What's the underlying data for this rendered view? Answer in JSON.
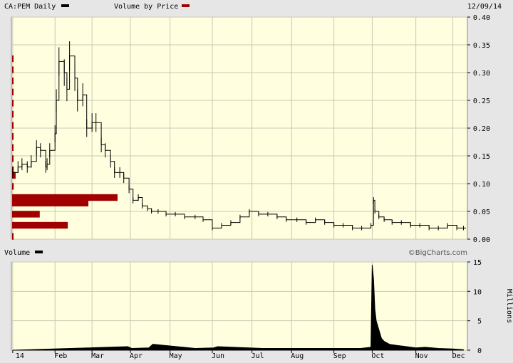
{
  "header": {
    "symbol_label": "CA:PEM Daily",
    "volume_by_price_label": "Volume by Price",
    "date": "12/09/14"
  },
  "volume_panel": {
    "label": "Volume",
    "watermark": "©BigCharts.com",
    "units_label": "Millions"
  },
  "colors": {
    "background": "#ffffe0",
    "grid": "#c8c8b4",
    "price_line": "#000000",
    "vbp_bar": "#a00000",
    "volume_fill": "#000000",
    "chrome": "#e6e6e6"
  },
  "chart_data": [
    {
      "type": "line",
      "title": "CA:PEM Daily",
      "x_tick_labels": [
        "14",
        "Feb",
        "Mar",
        "Apr",
        "May",
        "Jun",
        "Jul",
        "Aug",
        "Sep",
        "Oct",
        "Nov",
        "Dec"
      ],
      "y_tick_labels": [
        "0.00",
        "0.05",
        "0.10",
        "0.15",
        "0.20",
        "0.25",
        "0.30",
        "0.35",
        "0.40"
      ],
      "ylim": [
        0,
        0.4
      ],
      "grid": true,
      "series": [
        {
          "name": "CA:PEM Daily",
          "x": [
            "2014-01-02",
            "2014-01-06",
            "2014-01-09",
            "2014-01-13",
            "2014-01-16",
            "2014-01-20",
            "2014-01-23",
            "2014-01-27",
            "2014-01-28",
            "2014-01-30",
            "2014-02-03",
            "2014-02-04",
            "2014-02-06",
            "2014-02-10",
            "2014-02-12",
            "2014-02-14",
            "2014-02-18",
            "2014-02-20",
            "2014-02-24",
            "2014-02-27",
            "2014-03-03",
            "2014-03-06",
            "2014-03-10",
            "2014-03-13",
            "2014-03-17",
            "2014-03-20",
            "2014-03-24",
            "2014-03-27",
            "2014-03-31",
            "2014-04-03",
            "2014-04-07",
            "2014-04-10",
            "2014-04-14",
            "2014-04-17",
            "2014-04-22",
            "2014-04-28",
            "2014-05-05",
            "2014-05-12",
            "2014-05-20",
            "2014-05-26",
            "2014-06-02",
            "2014-06-09",
            "2014-06-16",
            "2014-06-23",
            "2014-06-30",
            "2014-07-07",
            "2014-07-14",
            "2014-07-21",
            "2014-07-28",
            "2014-08-05",
            "2014-08-12",
            "2014-08-19",
            "2014-08-26",
            "2014-09-02",
            "2014-09-09",
            "2014-09-16",
            "2014-09-23",
            "2014-09-30",
            "2014-10-02",
            "2014-10-03",
            "2014-10-06",
            "2014-10-10",
            "2014-10-16",
            "2014-10-23",
            "2014-10-30",
            "2014-11-06",
            "2014-11-13",
            "2014-11-20",
            "2014-11-27",
            "2014-12-04",
            "2014-12-09"
          ],
          "values": [
            0.12,
            0.13,
            0.135,
            0.13,
            0.14,
            0.165,
            0.16,
            0.13,
            0.135,
            0.16,
            0.19,
            0.25,
            0.32,
            0.3,
            0.27,
            0.33,
            0.29,
            0.25,
            0.26,
            0.2,
            0.21,
            0.21,
            0.17,
            0.16,
            0.14,
            0.12,
            0.12,
            0.11,
            0.09,
            0.07,
            0.075,
            0.06,
            0.055,
            0.05,
            0.05,
            0.045,
            0.045,
            0.04,
            0.04,
            0.035,
            0.02,
            0.025,
            0.03,
            0.04,
            0.05,
            0.045,
            0.045,
            0.04,
            0.035,
            0.035,
            0.03,
            0.035,
            0.03,
            0.025,
            0.025,
            0.02,
            0.02,
            0.025,
            0.07,
            0.05,
            0.04,
            0.035,
            0.03,
            0.03,
            0.025,
            0.025,
            0.02,
            0.02,
            0.025,
            0.02,
            0.02
          ]
        }
      ],
      "volume_by_price": {
        "price_levels": [
          0.005,
          0.025,
          0.045,
          0.065,
          0.075,
          0.095,
          0.115,
          0.125,
          0.145,
          0.165,
          0.185,
          0.205,
          0.225,
          0.245,
          0.265,
          0.285,
          0.305,
          0.325
        ],
        "volumes": [
          0.2,
          14.3,
          7.1,
          19.6,
          27.1,
          0.4,
          0.9,
          0.4,
          0.2,
          0.2,
          0.2,
          0.2,
          0.2,
          0.2,
          0.3,
          0.3,
          0.2,
          0.2
        ]
      }
    },
    {
      "type": "area",
      "title": "Volume",
      "ylabel": "Millions",
      "y_tick_labels": [
        "0",
        "5",
        "10",
        "15"
      ],
      "ylim": [
        0,
        15
      ],
      "grid": true,
      "x": [
        "2014-01-02",
        "2014-03-30",
        "2014-04-02",
        "2014-04-15",
        "2014-04-18",
        "2014-05-20",
        "2014-06-03",
        "2014-06-06",
        "2014-07-10",
        "2014-09-22",
        "2014-09-30",
        "2014-10-01",
        "2014-10-02",
        "2014-10-03",
        "2014-10-04",
        "2014-10-06",
        "2014-10-08",
        "2014-10-10",
        "2014-10-14",
        "2014-10-20",
        "2014-10-27",
        "2014-11-03",
        "2014-11-10",
        "2014-11-20",
        "2014-12-01",
        "2014-12-09"
      ],
      "values": [
        0,
        0.6,
        0.3,
        0.4,
        1.0,
        0.3,
        0.4,
        0.6,
        0.3,
        0.3,
        0.5,
        14.5,
        12.0,
        7.0,
        5.0,
        3.5,
        2.0,
        1.5,
        1.0,
        0.8,
        0.6,
        0.4,
        0.5,
        0.3,
        0.2,
        0.1
      ]
    }
  ]
}
